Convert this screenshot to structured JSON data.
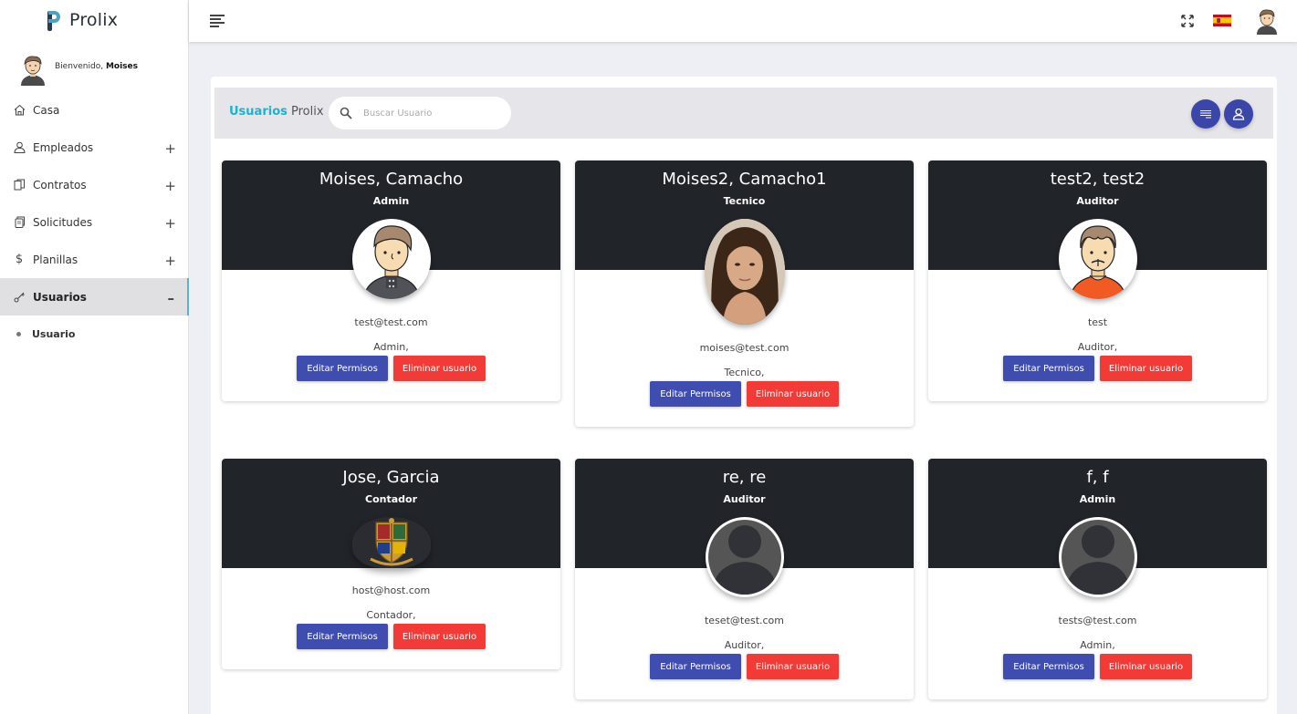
{
  "brand": {
    "name": "Prolix"
  },
  "welcome": {
    "prefix": "Bienvenido,",
    "user": "Moises"
  },
  "nav": [
    {
      "label": "Casa",
      "icon": "home-icon",
      "expander": ""
    },
    {
      "label": "Empleados",
      "icon": "user-icon",
      "expander": "+"
    },
    {
      "label": "Contratos",
      "icon": "documents-icon",
      "expander": "+"
    },
    {
      "label": "Solicitudes",
      "icon": "copy-icon",
      "expander": "+"
    },
    {
      "label": "Planillas",
      "icon": "dollar-icon",
      "expander": "+"
    },
    {
      "label": "Usuarios",
      "icon": "key-icon",
      "expander": "–"
    }
  ],
  "nav_sub": {
    "label": "Usuario"
  },
  "header": {
    "accent": "Usuarios",
    "title": "Prolix"
  },
  "search": {
    "placeholder": "Buscar Usuario",
    "value": ""
  },
  "buttons": {
    "edit": "Editar Permisos",
    "delete": "Eliminar usuario"
  },
  "users": [
    {
      "name": "Moises, Camacho",
      "role": "Admin",
      "email": "test@test.com",
      "role_line": "Admin,",
      "avatar": "male-avatar"
    },
    {
      "name": "Moises2, Camacho1",
      "role": "Tecnico",
      "email": "moises@test.com",
      "role_line": "Tecnico,",
      "avatar": "photo"
    },
    {
      "name": "test2, test2",
      "role": "Auditor",
      "email": "test",
      "role_line": "Auditor,",
      "avatar": "male-avatar-orange"
    },
    {
      "name": "Jose, Garcia",
      "role": "Contador",
      "email": "host@host.com",
      "role_line": "Contador,",
      "avatar": "crest"
    },
    {
      "name": "re, re",
      "role": "Auditor",
      "email": "teset@test.com",
      "role_line": "Auditor,",
      "avatar": "default-person"
    },
    {
      "name": "f, f",
      "role": "Admin",
      "email": "tests@test.com",
      "role_line": "Admin,",
      "avatar": "default-person"
    }
  ],
  "colors": {
    "sidebar_active_border": "#5ab3c7",
    "accent": "#1bb3cf",
    "edit_button": "#3f4db0",
    "delete_button": "#f23a36",
    "card_header": "#212429"
  }
}
